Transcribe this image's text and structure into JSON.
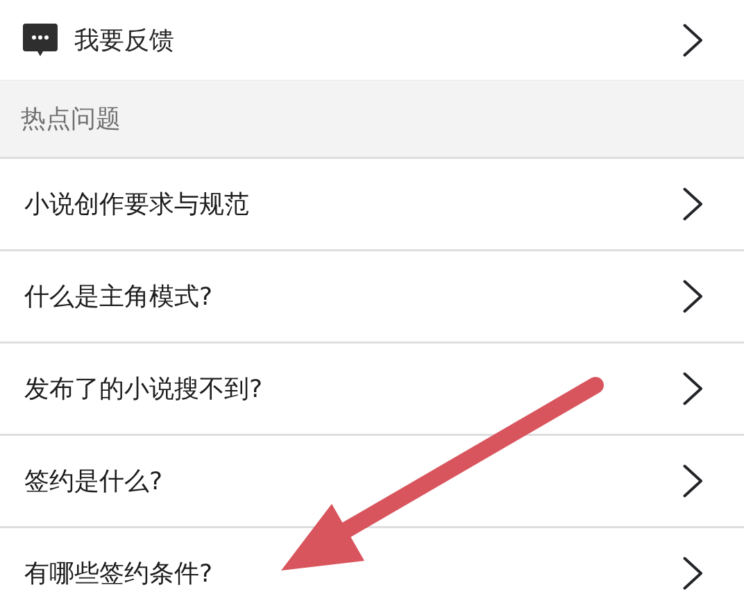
{
  "feedback": {
    "label": "我要反馈"
  },
  "section_header": {
    "title": "热点问题"
  },
  "questions": [
    {
      "label": "小说创作要求与规范"
    },
    {
      "label": "什么是主角模式?"
    },
    {
      "label": "发布了的小说搜不到?"
    },
    {
      "label": "签约是什么?"
    },
    {
      "label": "有哪些签约条件?"
    }
  ]
}
